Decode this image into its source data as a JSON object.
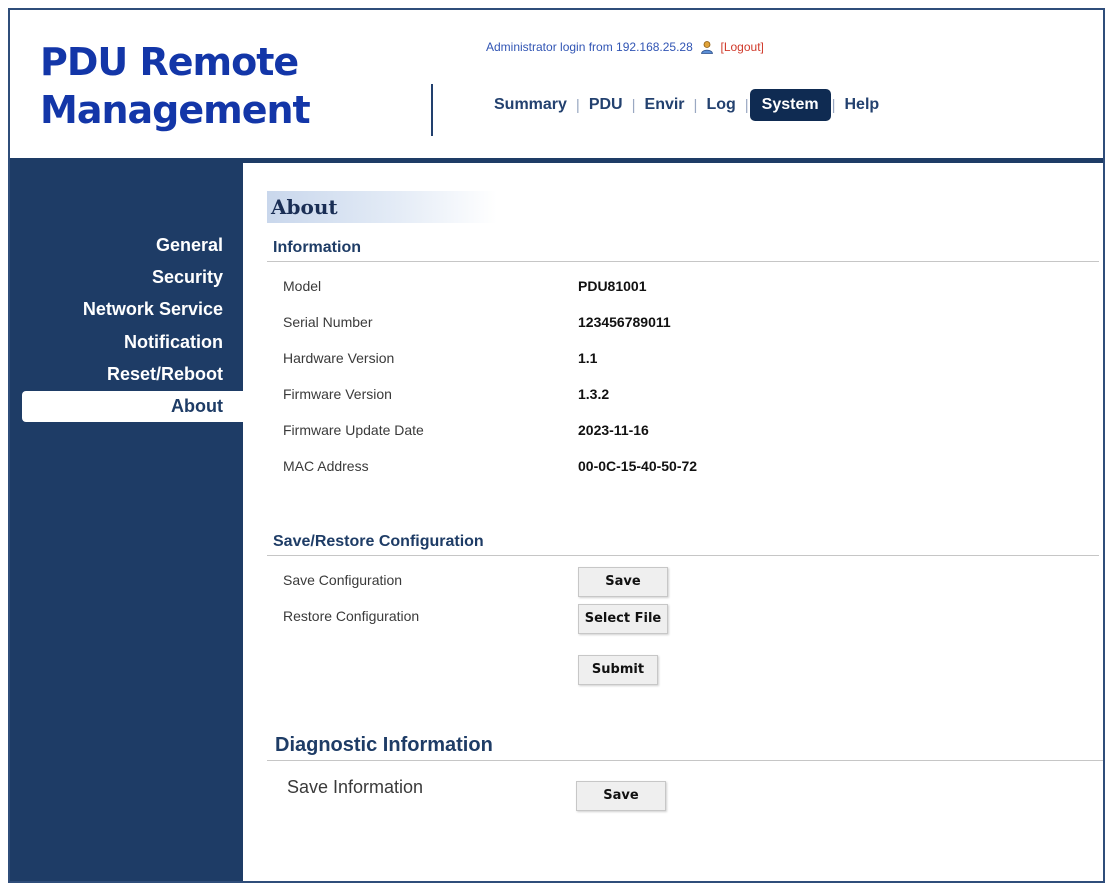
{
  "header": {
    "brand_line1": "PDU Remote",
    "brand_line2": "Management",
    "login_text": "Administrator login from 192.168.25.28",
    "logout_label": "[Logout]"
  },
  "nav": {
    "tabs": [
      {
        "label": "Summary"
      },
      {
        "label": "PDU"
      },
      {
        "label": "Envir"
      },
      {
        "label": "Log"
      },
      {
        "label": "System",
        "active": true
      },
      {
        "label": "Help"
      }
    ],
    "separator": "|"
  },
  "sidebar": {
    "items": [
      {
        "label": "General"
      },
      {
        "label": "Security"
      },
      {
        "label": "Network Service"
      },
      {
        "label": "Notification"
      },
      {
        "label": "Reset/Reboot"
      },
      {
        "label": "About",
        "active": true
      }
    ]
  },
  "page": {
    "title": "About",
    "information": {
      "heading": "Information",
      "rows": [
        {
          "label": "Model",
          "value": "PDU81001"
        },
        {
          "label": "Serial Number",
          "value": "123456789011"
        },
        {
          "label": "Hardware Version",
          "value": "1.1"
        },
        {
          "label": "Firmware Version",
          "value": "1.3.2"
        },
        {
          "label": "Firmware Update Date",
          "value": "2023-11-16"
        },
        {
          "label": "MAC Address",
          "value": "00-0C-15-40-50-72"
        }
      ]
    },
    "config": {
      "heading": "Save/Restore Configuration",
      "save_label": "Save Configuration",
      "save_button": "Save",
      "restore_label": "Restore Configuration",
      "select_file_button": "Select File",
      "submit_button": "Submit"
    },
    "diagnostic": {
      "heading": "Diagnostic Information",
      "save_label": "Save Information",
      "save_button": "Save"
    }
  },
  "colors": {
    "brand": "#1336a8",
    "navy": "#1e3c66",
    "active_tab": "#0f2b52",
    "logout": "#d03a2b"
  }
}
